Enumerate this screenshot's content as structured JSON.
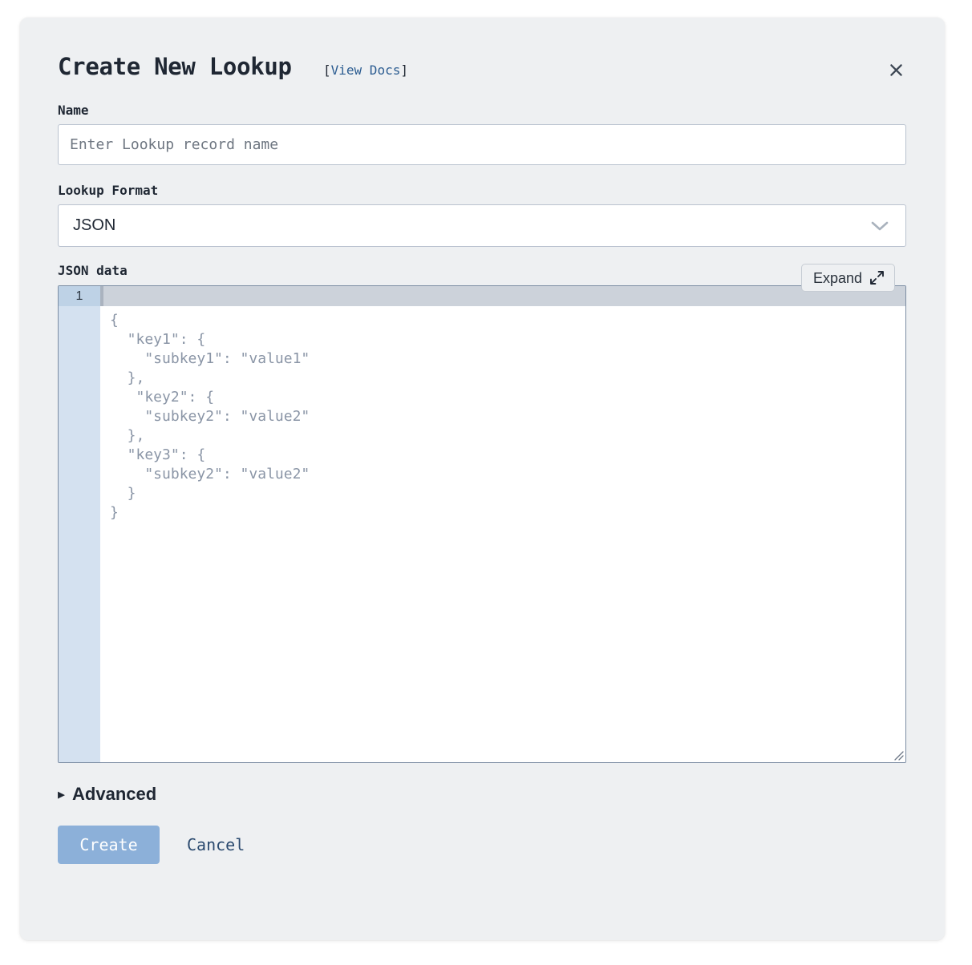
{
  "dialog": {
    "title": "Create New Lookup",
    "docs_link_prefix": "[",
    "docs_link_text": "View Docs",
    "docs_link_suffix": "]",
    "close_icon": "close-icon"
  },
  "name_field": {
    "label": "Name",
    "value": "",
    "placeholder": "Enter Lookup record name"
  },
  "format_field": {
    "label": "Lookup Format",
    "selected": "JSON",
    "options": [
      "JSON"
    ],
    "chevron_icon": "chevron-down-icon"
  },
  "json_editor": {
    "label": "JSON data",
    "expand_label": "Expand",
    "expand_icon": "expand-arrows-icon",
    "line_numbers": [
      "1"
    ],
    "value": "",
    "placeholder": "{\n  \"key1\": {\n    \"subkey1\": \"value1\"\n  },\n   \"key2\": {\n    \"subkey2\": \"value2\"\n  },\n  \"key3\": {\n    \"subkey2\": \"value2\"\n  }\n}",
    "resize_handle_icon": "resize-grip-icon"
  },
  "advanced": {
    "label": "Advanced",
    "caret_icon": "triangle-right-icon",
    "expanded": false
  },
  "actions": {
    "create_label": "Create",
    "cancel_label": "Cancel"
  },
  "colors": {
    "card_background": "#eef0f2",
    "page_background": "#ffffff",
    "primary_button": "#8cb0d9",
    "link": "#2b5c91",
    "gutter": "#d4e1f0",
    "gutter_active": "#bed2e6",
    "editor_topbar": "#ccd2da",
    "code_text": "#8a95a6",
    "input_border": "#b9c2cf",
    "editor_border": "#7c8da3"
  }
}
